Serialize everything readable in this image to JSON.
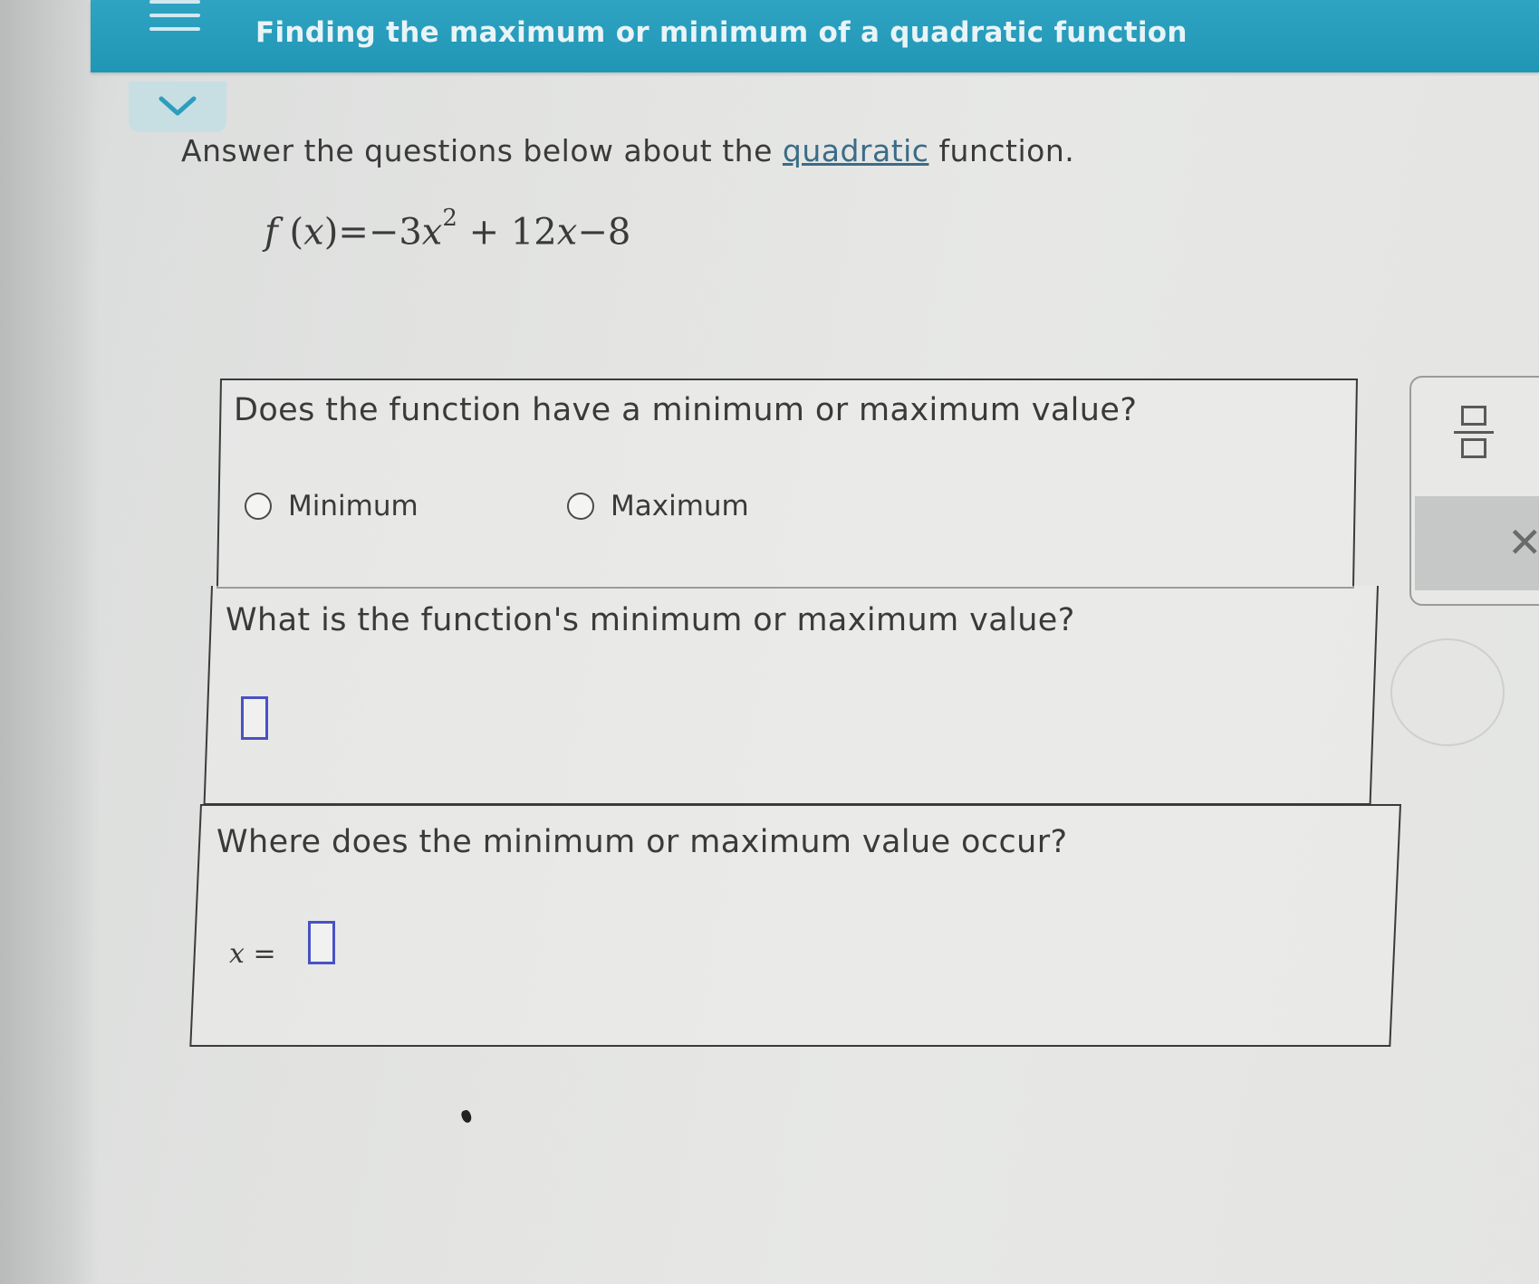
{
  "header": {
    "title": "Finding the maximum or minimum of a quadratic function"
  },
  "instructions": {
    "prefix": "Answer the questions below about the ",
    "link": "quadratic",
    "suffix": " function."
  },
  "equation": {
    "lhs_f": "f",
    "lhs_x": "x",
    "eq": "=",
    "coef": "−3",
    "var": "x",
    "exp": "2",
    "plus": "+",
    "linear_coef": "12",
    "linear_var": "x",
    "minus": "−",
    "constant": "8"
  },
  "questions": {
    "q1": {
      "text": "Does the function have a minimum or maximum value?",
      "options": [
        "Minimum",
        "Maximum"
      ]
    },
    "q2": {
      "text": "What is the function's minimum or maximum value?"
    },
    "q3": {
      "text": "Where does the minimum or maximum value occur?",
      "var": "x",
      "eq": "="
    }
  },
  "tools": {
    "clear_symbol": "✕"
  },
  "colors": {
    "header": "#2096b5",
    "link": "#3a6c87",
    "answer_box": "#4852c4"
  }
}
